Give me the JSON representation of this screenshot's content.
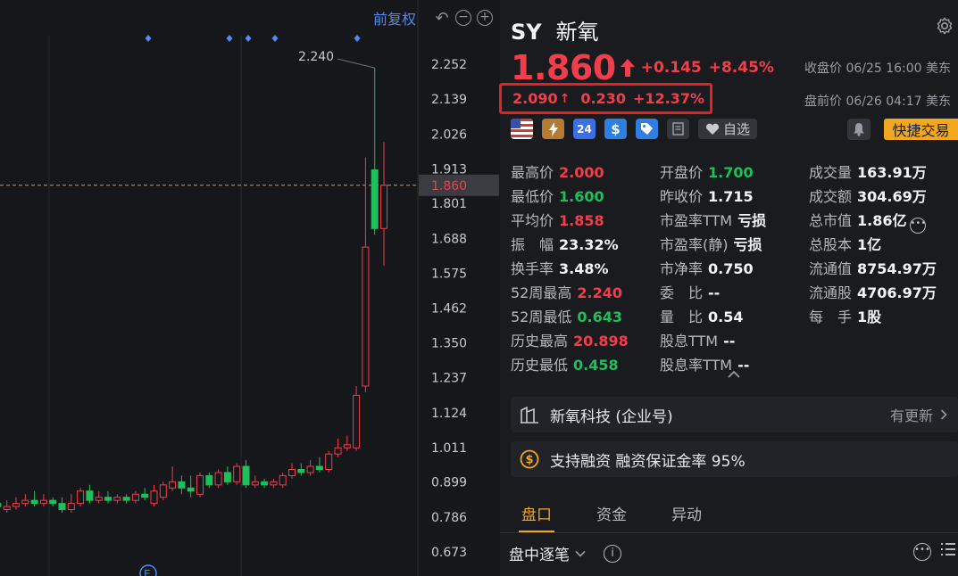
{
  "chart": {
    "fuquan_label": "前复权",
    "price_axis": [
      "2.252",
      "2.139",
      "2.026",
      "1.913",
      "1.801",
      "1.688",
      "1.575",
      "1.462",
      "1.350",
      "1.237",
      "1.124",
      "1.011",
      "0.899",
      "0.786",
      "0.673"
    ],
    "current_price_tag": "1.860",
    "high_annotation": "2.240",
    "earnings_marker": "E"
  },
  "chart_data": {
    "type": "candlestick",
    "y_ticks": [
      2.252,
      2.139,
      2.026,
      1.913,
      1.801,
      1.688,
      1.575,
      1.462,
      1.35,
      1.237,
      1.124,
      1.011,
      0.899,
      0.786,
      0.673
    ],
    "ylim": [
      0.62,
      2.33
    ],
    "current_price": 1.86,
    "max_label": 2.24,
    "candles": [
      {
        "o": 0.83,
        "c": 0.82,
        "h": 0.84,
        "l": 0.8
      },
      {
        "o": 0.82,
        "c": 0.81,
        "h": 0.84,
        "l": 0.79
      },
      {
        "o": 0.82,
        "c": 0.83,
        "h": 0.85,
        "l": 0.81
      },
      {
        "o": 0.83,
        "c": 0.82,
        "h": 0.84,
        "l": 0.8
      },
      {
        "o": 0.82,
        "c": 0.81,
        "h": 0.83,
        "l": 0.8
      },
      {
        "o": 0.81,
        "c": 0.8,
        "h": 0.83,
        "l": 0.78
      },
      {
        "o": 0.8,
        "c": 0.77,
        "h": 0.81,
        "l": 0.72
      },
      {
        "o": 0.79,
        "c": 0.83,
        "h": 0.86,
        "l": 0.78
      },
      {
        "o": 0.83,
        "c": 0.82,
        "h": 0.87,
        "l": 0.8
      },
      {
        "o": 0.82,
        "c": 0.83,
        "h": 0.85,
        "l": 0.81
      },
      {
        "o": 0.83,
        "c": 0.82,
        "h": 0.84,
        "l": 0.81
      },
      {
        "o": 0.81,
        "c": 0.82,
        "h": 0.84,
        "l": 0.8
      },
      {
        "o": 0.82,
        "c": 0.83,
        "h": 0.85,
        "l": 0.81
      },
      {
        "o": 0.83,
        "c": 0.84,
        "h": 0.86,
        "l": 0.82
      },
      {
        "o": 0.84,
        "c": 0.83,
        "h": 0.87,
        "l": 0.82
      },
      {
        "o": 0.83,
        "c": 0.84,
        "h": 0.86,
        "l": 0.82
      },
      {
        "o": 0.84,
        "c": 0.83,
        "h": 0.85,
        "l": 0.82
      },
      {
        "o": 0.83,
        "c": 0.81,
        "h": 0.85,
        "l": 0.8
      },
      {
        "o": 0.81,
        "c": 0.83,
        "h": 0.86,
        "l": 0.8
      },
      {
        "o": 0.83,
        "c": 0.87,
        "h": 0.88,
        "l": 0.82
      },
      {
        "o": 0.87,
        "c": 0.84,
        "h": 0.89,
        "l": 0.83
      },
      {
        "o": 0.84,
        "c": 0.85,
        "h": 0.87,
        "l": 0.83
      },
      {
        "o": 0.85,
        "c": 0.84,
        "h": 0.87,
        "l": 0.83
      },
      {
        "o": 0.84,
        "c": 0.85,
        "h": 0.86,
        "l": 0.83
      },
      {
        "o": 0.85,
        "c": 0.84,
        "h": 0.86,
        "l": 0.83
      },
      {
        "o": 0.84,
        "c": 0.86,
        "h": 0.87,
        "l": 0.83
      },
      {
        "o": 0.86,
        "c": 0.85,
        "h": 0.88,
        "l": 0.84
      },
      {
        "o": 0.83,
        "c": 0.87,
        "h": 0.89,
        "l": 0.82
      },
      {
        "o": 0.85,
        "c": 0.89,
        "h": 0.9,
        "l": 0.84
      },
      {
        "o": 0.88,
        "c": 0.9,
        "h": 0.95,
        "l": 0.87
      },
      {
        "o": 0.9,
        "c": 0.88,
        "h": 0.92,
        "l": 0.86
      },
      {
        "o": 0.88,
        "c": 0.87,
        "h": 0.92,
        "l": 0.85
      },
      {
        "o": 0.86,
        "c": 0.92,
        "h": 0.93,
        "l": 0.85
      },
      {
        "o": 0.92,
        "c": 0.89,
        "h": 0.93,
        "l": 0.88
      },
      {
        "o": 0.89,
        "c": 0.93,
        "h": 0.94,
        "l": 0.88
      },
      {
        "o": 0.93,
        "c": 0.9,
        "h": 0.95,
        "l": 0.89
      },
      {
        "o": 0.9,
        "c": 0.95,
        "h": 0.96,
        "l": 0.89
      },
      {
        "o": 0.95,
        "c": 0.89,
        "h": 0.97,
        "l": 0.88
      },
      {
        "o": 0.89,
        "c": 0.9,
        "h": 0.92,
        "l": 0.88
      },
      {
        "o": 0.9,
        "c": 0.89,
        "h": 0.91,
        "l": 0.88
      },
      {
        "o": 0.89,
        "c": 0.9,
        "h": 0.91,
        "l": 0.88
      },
      {
        "o": 0.89,
        "c": 0.92,
        "h": 0.93,
        "l": 0.88
      },
      {
        "o": 0.92,
        "c": 0.94,
        "h": 0.96,
        "l": 0.91
      },
      {
        "o": 0.94,
        "c": 0.93,
        "h": 0.96,
        "l": 0.92
      },
      {
        "o": 0.93,
        "c": 0.95,
        "h": 0.97,
        "l": 0.92
      },
      {
        "o": 0.95,
        "c": 0.94,
        "h": 0.98,
        "l": 0.93
      },
      {
        "o": 0.94,
        "c": 0.99,
        "h": 1.0,
        "l": 0.93
      },
      {
        "o": 0.99,
        "c": 1.01,
        "h": 1.04,
        "l": 0.98
      },
      {
        "o": 1.01,
        "c": 1.02,
        "h": 1.05,
        "l": 1.0
      },
      {
        "o": 1.01,
        "c": 1.18,
        "h": 1.21,
        "l": 1.0
      },
      {
        "o": 1.21,
        "c": 1.66,
        "h": 1.95,
        "l": 1.19
      },
      {
        "o": 1.91,
        "c": 1.72,
        "h": 2.24,
        "l": 1.7
      },
      {
        "o": 1.72,
        "c": 1.86,
        "h": 2.0,
        "l": 1.6
      }
    ],
    "event_markers": 5
  },
  "quote": {
    "ticker": "SY",
    "name": "新氧",
    "price": "1.860",
    "change": "+0.145",
    "change_pct": "+8.45%",
    "close_info": "收盘价 06/25 16:00 美东",
    "premarket_price": "2.090",
    "premarket_arrow": "↑",
    "premarket_change": "0.230",
    "premarket_pct": "+12.37%",
    "premarket_info": "盘前价 06/26 04:17 美东",
    "badges": {
      "num24": "24",
      "dollar": "$"
    },
    "watch_label": "自选",
    "quick_trade_label": "快捷交易",
    "stats": {
      "high_lbl": "最高价",
      "high_val": "2.000",
      "low_lbl": "最低价",
      "low_val": "1.600",
      "avg_lbl": "平均价",
      "avg_val": "1.858",
      "amp_lbl": "振　幅",
      "amp_val": "23.32%",
      "turnover_lbl": "换手率",
      "turnover_val": "3.48%",
      "w52h_lbl": "52周最高",
      "w52h_val": "2.240",
      "w52l_lbl": "52周最低",
      "w52l_val": "0.643",
      "hish_lbl": "历史最高",
      "hish_val": "20.898",
      "hisl_lbl": "历史最低",
      "hisl_val": "0.458",
      "open_lbl": "开盘价",
      "open_val": "1.700",
      "prev_lbl": "昨收价",
      "prev_val": "1.715",
      "pettm_lbl": "市盈率TTM",
      "pettm_val": "亏损",
      "pes_lbl": "市盈率(静)",
      "pes_val": "亏损",
      "pb_lbl": "市净率",
      "pb_val": "0.750",
      "wb_lbl": "委　比",
      "wb_val": "--",
      "lb_lbl": "量　比",
      "lb_val": "0.54",
      "divttm_lbl": "股息TTM",
      "divttm_val": "--",
      "divr_lbl": "股息率TTM",
      "divr_val": "--",
      "vol_lbl": "成交量",
      "vol_val": "163.91万",
      "amt_lbl": "成交额",
      "amt_val": "304.69万",
      "mcap_lbl": "总市值",
      "mcap_val": "1.86亿",
      "shares_lbl": "总股本",
      "shares_val": "1亿",
      "fmcap_lbl": "流通值",
      "fmcap_val": "8754.97万",
      "fshares_lbl": "流通股",
      "fshares_val": "4706.97万",
      "lot_lbl": "每　手",
      "lot_val": "1股"
    },
    "company_card": {
      "label": "新氧科技 (企业号)",
      "update": "有更新"
    },
    "margin_card": {
      "label": "支持融资 融资保证金率 95%"
    },
    "tabs": [
      "盘口",
      "资金",
      "异动"
    ],
    "ticks_header": "盘中逐笔"
  },
  "colors": {
    "up": "#f23d4a",
    "down": "#1fbf5c",
    "accent": "#f2a81e",
    "link": "#4f8bf0"
  }
}
